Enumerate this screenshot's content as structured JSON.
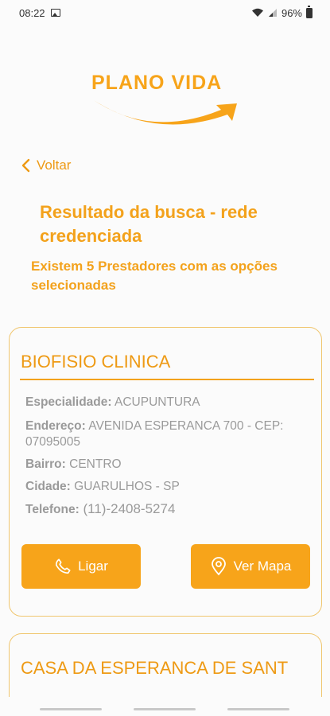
{
  "status": {
    "time": "08:22",
    "battery": "96%"
  },
  "logo": {
    "text": "PLANO VIDA"
  },
  "nav": {
    "back_label": "Voltar"
  },
  "page": {
    "title": "Resultado da busca - rede credenciada",
    "subtitle": "Existem 5 Prestadores com as opções selecionadas"
  },
  "results": [
    {
      "name": "BIOFISIO CLINICA",
      "especialidade_label": "Especialidade:",
      "especialidade": "ACUPUNTURA",
      "endereco_label": "Endereço:",
      "endereco": "AVENIDA ESPERANCA 700  - CEP: 07095005",
      "bairro_label": "Bairro:",
      "bairro": "CENTRO",
      "cidade_label": "Cidade:",
      "cidade": "GUARULHOS - SP",
      "telefone_label": "Telefone:",
      "telefone": "(11)-2408-5274",
      "call_label": "Ligar",
      "map_label": "Ver Mapa"
    },
    {
      "name": "CASA DA ESPERANCA DE SANT"
    }
  ],
  "colors": {
    "accent": "#f7a41a",
    "card_border": "#f0c66f",
    "text_muted": "#9a9a9a"
  }
}
